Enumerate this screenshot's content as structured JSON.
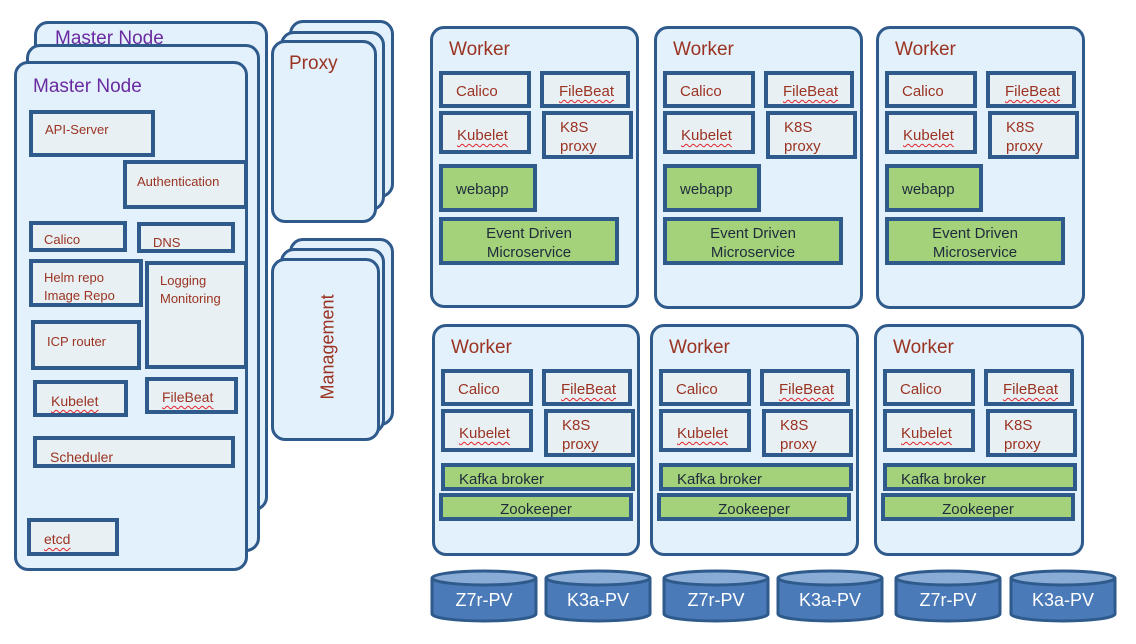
{
  "master": {
    "stack_title": "Master Node",
    "title": "Master Node",
    "components": {
      "api_server": "API-Server",
      "authentication": "Authentication",
      "calico": "Calico",
      "dns": "DNS",
      "helm_repo": "Helm repo",
      "image_repo": "Image Repo",
      "logging": "Logging",
      "monitoring": "Monitoring",
      "icp_router": "ICP router",
      "kubelet": "Kubelet",
      "filebeat": "FileBeat",
      "scheduler": "Scheduler",
      "etcd": "etcd"
    }
  },
  "proxy": {
    "title": "Proxy"
  },
  "management": {
    "title": "Management"
  },
  "workers": [
    {
      "title": "Worker",
      "calico": "Calico",
      "filebeat": "FileBeat",
      "kubelet": "Kubelet",
      "k8s": "K8S",
      "proxy": "proxy",
      "app1": "webapp",
      "app2_line1": "Event Driven",
      "app2_line2": "Microservice"
    },
    {
      "title": "Worker",
      "calico": "Calico",
      "filebeat": "FileBeat",
      "kubelet": "Kubelet",
      "k8s": "K8S",
      "proxy": "proxy",
      "app1": "webapp",
      "app2_line1": "Event Driven",
      "app2_line2": "Microservice"
    },
    {
      "title": "Worker",
      "calico": "Calico",
      "filebeat": "FileBeat",
      "kubelet": "Kubelet",
      "k8s": "K8S",
      "proxy": "proxy",
      "app1": "webapp",
      "app2_line1": "Event Driven",
      "app2_line2": "Microservice"
    },
    {
      "title": "Worker",
      "calico": "Calico",
      "filebeat": "FileBeat",
      "kubelet": "Kubelet",
      "k8s": "K8S",
      "proxy": "proxy",
      "app1": "Kafka broker",
      "app2": "Zookeeper"
    },
    {
      "title": "Worker",
      "calico": "Calico",
      "filebeat": "FileBeat",
      "kubelet": "Kubelet",
      "k8s": "K8S",
      "proxy": "proxy",
      "app1": "Kafka broker",
      "app2": "Zookeeper"
    },
    {
      "title": "Worker",
      "calico": "Calico",
      "filebeat": "FileBeat",
      "kubelet": "Kubelet",
      "k8s": "K8S",
      "proxy": "proxy",
      "app1": "Kafka broker",
      "app2": "Zookeeper"
    }
  ],
  "volumes": [
    "Z7r-PV",
    "K3a-PV",
    "Z7r-PV",
    "K3a-PV",
    "Z7r-PV",
    "K3a-PV"
  ],
  "colors": {
    "border": "#2f5a8c",
    "node_fill": "#e3f1fc",
    "component_fill": "#e9f0f4",
    "app_fill": "#a3d27a",
    "component_text": "#9a3321",
    "master_title": "#6a2aa0",
    "volume_fill": "#4a7ab8"
  }
}
